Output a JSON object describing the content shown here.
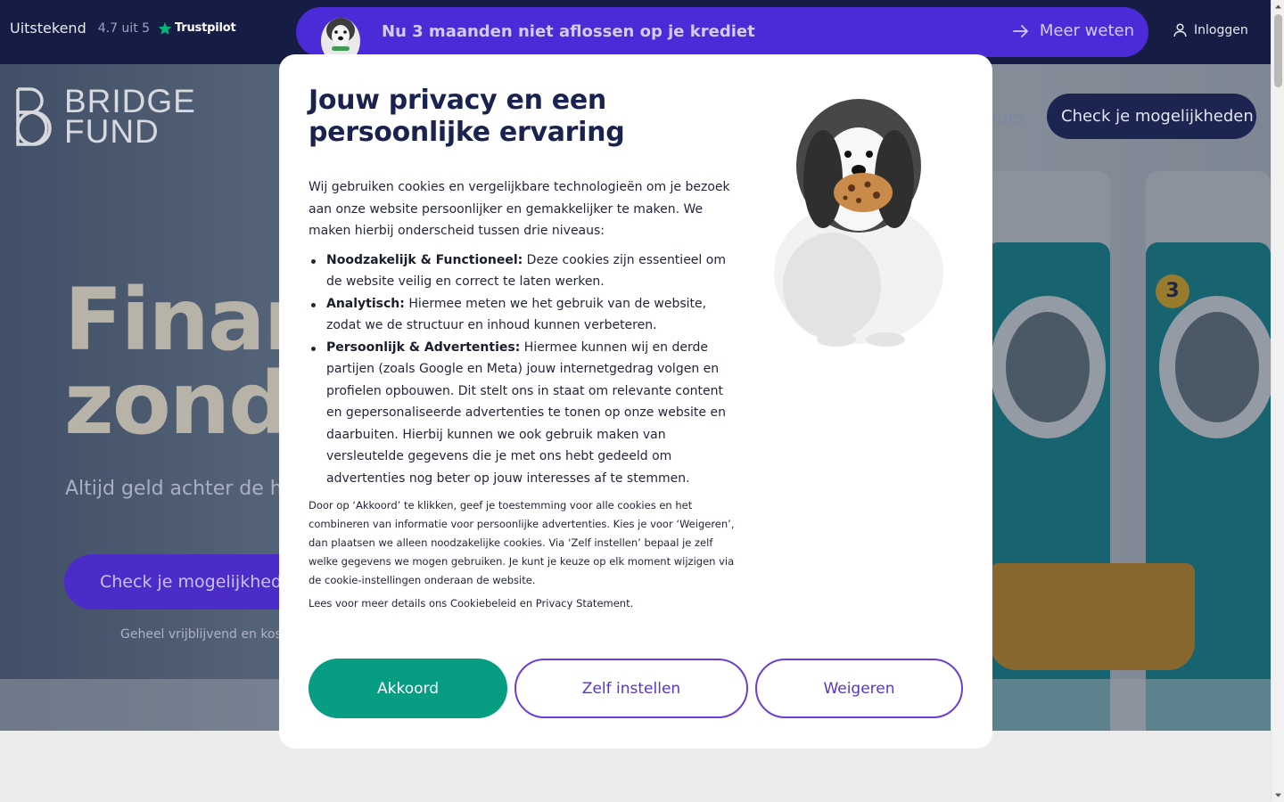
{
  "topbar": {
    "trustpilot": {
      "rating_label": "Uitstekend",
      "score": "4.7 uit 5",
      "brand": "Trustpilot"
    },
    "promo": {
      "text": "Nu 3 maanden niet aflossen op je krediet",
      "cta": "Meer weten"
    },
    "login": "Inloggen"
  },
  "hero": {
    "logo_line1": "BRIDGE",
    "logo_line2": "FUND",
    "headline_line1": "Finan",
    "headline_line2": "zond",
    "subtitle": "Altijd geld achter de h",
    "cta": "Check je mogelijkhed",
    "note": "Geheel vrijblijvend en koste",
    "nav_partial": "eurs",
    "nav_cta": "Check je mogelijkheden",
    "machine_badge": "3"
  },
  "modal": {
    "title": "Jouw privacy en een persoonlijke ervaring",
    "intro": "Wij gebruiken cookies en vergelijkbare technologieën om je bezoek aan onze website persoonlijker en gemakkelijker te maken. We maken hierbij onderscheid tussen drie niveaus:",
    "levels": [
      {
        "name": "Noodzakelijk & Functioneel:",
        "desc": " Deze cookies zijn essentieel om de website veilig en correct te laten werken."
      },
      {
        "name": "Analytisch:",
        "desc": " Hiermee meten we het gebruik van de website, zodat we de structuur en inhoud kunnen verbeteren."
      },
      {
        "name": "Persoonlijk & Advertenties:",
        "desc": " Hiermee kunnen wij en derde partijen (zoals Google en Meta) jouw internetgedrag volgen en profielen opbouwen. Dit stelt ons in staat om relevante content en gepersonaliseerde advertenties te tonen op onze website en daarbuiten. Hierbij kunnen we ook gebruik maken van versleutelde gegevens die je met ons hebt gedeeld om advertenties nog beter op jouw interesses af te stemmen."
      }
    ],
    "consent_note": "Door op ‘Akkoord’ te klikken, geef je toestemming voor alle cookies en het combineren van informatie voor persoonlijke advertenties. Kies je voor ‘Weigeren’, dan plaatsen we alleen noodzakelijke cookies. Via ‘Zelf instellen’ bepaal je zelf welke gegevens we mogen gebruiken. Je kunt je keuze op elk moment wijzigen via de cookie-instellingen onderaan de website.",
    "more_info": "Lees voor meer details ons Cookiebeleid en Privacy Statement.",
    "buttons": {
      "accept": "Akkoord",
      "custom": "Zelf instellen",
      "deny": "Weigeren"
    }
  },
  "colors": {
    "navy": "#161d45",
    "purple": "#4b2bd8",
    "green": "#069d82",
    "outline_purple": "#6a3ed9",
    "title_navy": "#1a2350"
  }
}
